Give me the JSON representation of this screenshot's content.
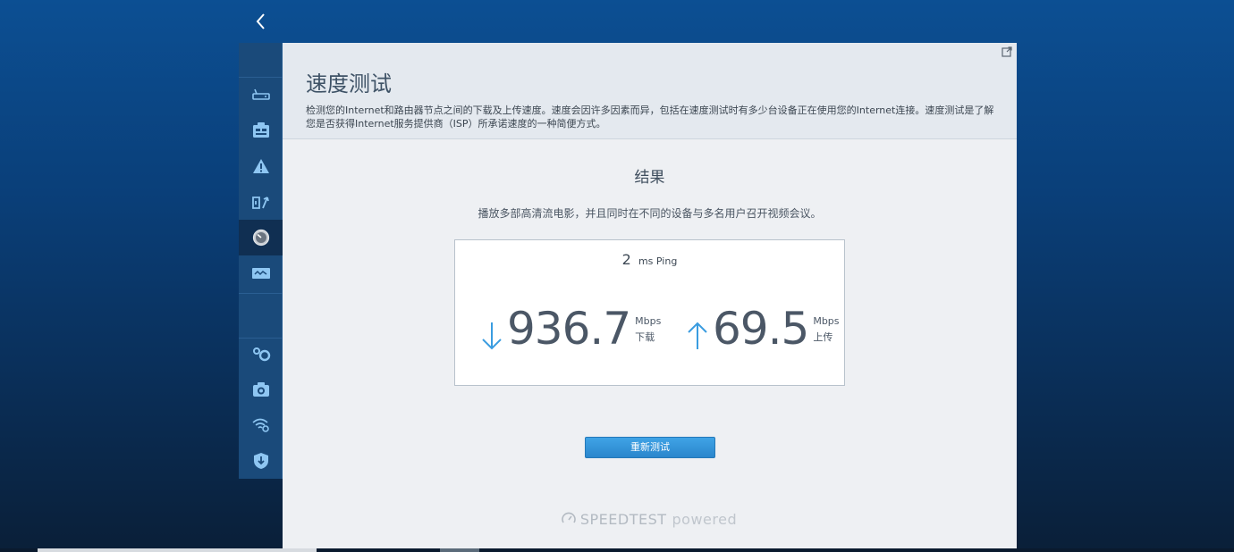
{
  "sidebar": {
    "back_icon": "chevron-left-icon",
    "items": [
      {
        "icon": "router-icon"
      },
      {
        "icon": "device-list-icon"
      },
      {
        "icon": "alert-icon"
      },
      {
        "icon": "parental-controls-icon"
      },
      {
        "icon": "speed-gauge-icon",
        "active": true
      },
      {
        "icon": "network-map-icon"
      },
      {
        "icon": "connectivity-icon"
      },
      {
        "icon": "camera-icon"
      },
      {
        "icon": "wifi-settings-icon"
      },
      {
        "icon": "security-shield-icon"
      }
    ]
  },
  "page": {
    "title": "速度测试",
    "description": "检测您的Internet和路由器节点之间的下载及上传速度。速度会因许多因素而异，包括在速度测试时有多少台设备正在使用您的Internet连接。速度测试是了解您是否获得Internet服务提供商（ISP）所承诺速度的一种简便方式。"
  },
  "results": {
    "title": "结果",
    "subtitle": "播放多部高清流电影，并且同时在不同的设备与多名用户召开视频会议。",
    "ping": {
      "value": "2",
      "label": "ms Ping"
    },
    "download": {
      "value": "936.7",
      "unit": "Mbps",
      "label": "下载"
    },
    "upload": {
      "value": "69.5",
      "unit": "Mbps",
      "label": "上传"
    }
  },
  "actions": {
    "retest_label": "重新测试"
  },
  "branding": {
    "speedtest": "SPEEDTEST",
    "powered": "powered"
  },
  "colors": {
    "accent_blue": "#2e8ed6",
    "arrow_blue": "#3a9ce0",
    "text_dark": "#4b5766"
  }
}
